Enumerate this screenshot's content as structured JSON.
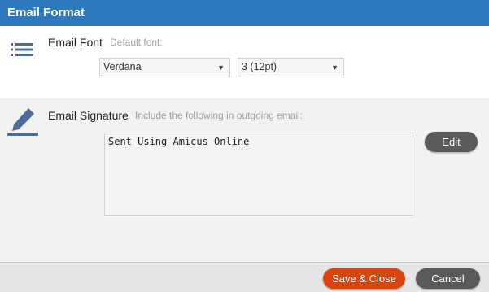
{
  "window": {
    "title": "Email Format"
  },
  "font_section": {
    "label": "Email Font",
    "hint": "Default font:",
    "icon": "list-icon",
    "font_family": {
      "selected": "Verdana"
    },
    "font_size": {
      "selected": "3 (12pt)"
    }
  },
  "signature_section": {
    "label": "Email Signature",
    "hint": "Include the following in outgoing email:",
    "icon": "pencil-icon",
    "text": "Sent Using Amicus Online",
    "edit_label": "Edit"
  },
  "footer": {
    "save_label": "Save & Close",
    "cancel_label": "Cancel"
  },
  "colors": {
    "titlebar": "#2e78bd",
    "accent_button": "#d9440f",
    "neutral_button": "#5a5a5a",
    "icon": "#4a6b9c"
  }
}
